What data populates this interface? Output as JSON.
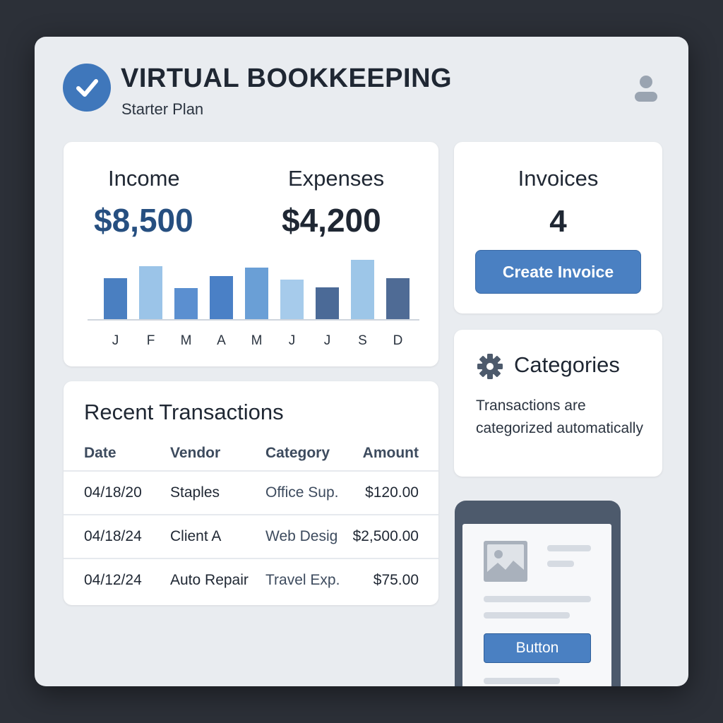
{
  "header": {
    "title": "VIRTUAL BOOKKEEPING",
    "plan": "Starter Plan"
  },
  "summary": {
    "income_label": "Income",
    "income_value": "$8,500",
    "expenses_label": "Expenses",
    "expenses_value": "$4,200"
  },
  "chart_data": {
    "type": "bar",
    "categories": [
      "J",
      "F",
      "M",
      "A",
      "M",
      "J",
      "J",
      "S",
      "D"
    ],
    "values": [
      58,
      75,
      44,
      61,
      73,
      56,
      45,
      84,
      58
    ],
    "ylim": [
      0,
      100
    ],
    "colors": [
      "#4a7fc1",
      "#9bc4e8",
      "#5b8fd0",
      "#4a80c6",
      "#6a9fd6",
      "#a6cbeb",
      "#4b6a97",
      "#9dc6e8",
      "#4f6b95"
    ],
    "title": "",
    "xlabel": "",
    "ylabel": "",
    "grid": false
  },
  "invoices": {
    "label": "Invoices",
    "count": "4",
    "button_label": "Create Invoice"
  },
  "categories": {
    "title": "Categories",
    "description": "Transactions are categorized automatically"
  },
  "transactions": {
    "title": "Recent Transactions",
    "columns": [
      "Date",
      "Vendor",
      "Category",
      "Amount"
    ],
    "rows": [
      {
        "date": "04/18/20",
        "vendor": "Staples",
        "category": "Office Sup.",
        "amount": "$120.00"
      },
      {
        "date": "04/18/24",
        "vendor": "Client A",
        "category": "Web Desig",
        "amount": "$2,500.00"
      },
      {
        "date": "04/12/24",
        "vendor": "Auto Repair",
        "category": "Travel Exp.",
        "amount": "$75.00"
      }
    ]
  },
  "mockup": {
    "button_label": "Button"
  },
  "icons": {
    "logo": "checkmark-icon",
    "avatar": "user-icon",
    "categories": "gear-icon",
    "mockup_image": "image-icon"
  },
  "colors": {
    "accent": "#4a80c2",
    "brand": "#3f77bb",
    "background": "#2c3038",
    "panel": "#e9ecf0",
    "income": "#264f80"
  }
}
